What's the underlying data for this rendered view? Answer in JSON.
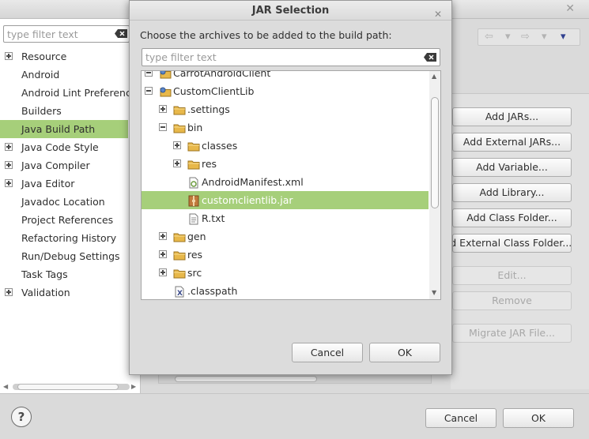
{
  "preferences": {
    "filter_placeholder": "type filter text",
    "items": [
      {
        "label": "Resource",
        "expandable": true
      },
      {
        "label": "Android",
        "expandable": false
      },
      {
        "label": "Android Lint Preferences",
        "expandable": false
      },
      {
        "label": "Builders",
        "expandable": false
      },
      {
        "label": "Java Build Path",
        "expandable": false,
        "selected": true
      },
      {
        "label": "Java Code Style",
        "expandable": true
      },
      {
        "label": "Java Compiler",
        "expandable": true
      },
      {
        "label": "Java Editor",
        "expandable": true
      },
      {
        "label": "Javadoc Location",
        "expandable": false
      },
      {
        "label": "Project References",
        "expandable": false
      },
      {
        "label": "Refactoring History",
        "expandable": false
      },
      {
        "label": "Run/Debug Settings",
        "expandable": false
      },
      {
        "label": "Task Tags",
        "expandable": false
      },
      {
        "label": "Validation",
        "expandable": true
      }
    ]
  },
  "build_path": {
    "buttons": [
      {
        "label": "Add JARs...",
        "enabled": true
      },
      {
        "label": "Add External JARs...",
        "enabled": true
      },
      {
        "label": "Add Variable...",
        "enabled": true
      },
      {
        "label": "Add Library...",
        "enabled": true
      },
      {
        "label": "Add Class Folder...",
        "enabled": true
      },
      {
        "label": "Add External Class Folder...",
        "enabled": true
      },
      {
        "label": "Edit...",
        "enabled": false
      },
      {
        "label": "Remove",
        "enabled": false
      },
      {
        "label": "Migrate JAR File...",
        "enabled": false
      }
    ]
  },
  "footer": {
    "help_glyph": "?",
    "cancel_label": "Cancel",
    "ok_label": "OK"
  },
  "dialog": {
    "title": "JAR Selection",
    "prompt": "Choose the archives to be added to the build path:",
    "filter_placeholder": "type filter text",
    "tree": [
      {
        "label": "CarrotAndroidClient",
        "depth": 0,
        "toggle": "minus",
        "icon": "project",
        "partial": true
      },
      {
        "label": "CustomClientLib",
        "depth": 0,
        "toggle": "minus",
        "icon": "project"
      },
      {
        "label": ".settings",
        "depth": 1,
        "toggle": "plus",
        "icon": "folder"
      },
      {
        "label": "bin",
        "depth": 1,
        "toggle": "minus",
        "icon": "folder"
      },
      {
        "label": "classes",
        "depth": 2,
        "toggle": "plus",
        "icon": "folder"
      },
      {
        "label": "res",
        "depth": 2,
        "toggle": "plus",
        "icon": "folder"
      },
      {
        "label": "AndroidManifest.xml",
        "depth": 2,
        "toggle": "none",
        "icon": "xml-file"
      },
      {
        "label": "customclientlib.jar",
        "depth": 2,
        "toggle": "none",
        "icon": "jar-file",
        "selected": true
      },
      {
        "label": "R.txt",
        "depth": 2,
        "toggle": "none",
        "icon": "text-file"
      },
      {
        "label": "gen",
        "depth": 1,
        "toggle": "plus",
        "icon": "folder"
      },
      {
        "label": "res",
        "depth": 1,
        "toggle": "plus",
        "icon": "folder"
      },
      {
        "label": "src",
        "depth": 1,
        "toggle": "plus",
        "icon": "folder"
      },
      {
        "label": ".classpath",
        "depth": 1,
        "toggle": "none",
        "icon": "classpath-file"
      }
    ],
    "cancel_label": "Cancel",
    "ok_label": "OK"
  },
  "colors": {
    "selection": "#a6cf7a",
    "folder": "#e8b84a"
  }
}
